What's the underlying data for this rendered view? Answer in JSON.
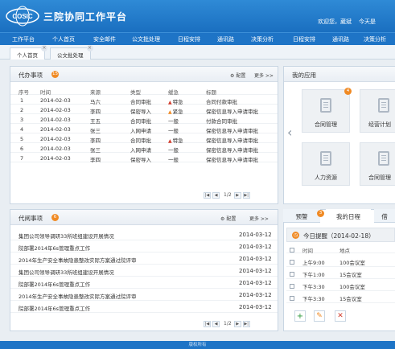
{
  "header": {
    "logo_text": "COSIC",
    "title": "三院协同工作平台",
    "welcome": "欢迎您，葳斌",
    "today": "今天是"
  },
  "nav": [
    "工作平台",
    "个人首页",
    "安全邮件",
    "公文批处理",
    "日程安排",
    "通讯路",
    "决策分析",
    "日程安排",
    "通讯路",
    "决策分析"
  ],
  "tabs": [
    "个人首页",
    "公文批处理"
  ],
  "todo": {
    "title": "代办事项",
    "badge": "15",
    "config": "配置",
    "more": "更多 >>",
    "columns": [
      "序号",
      "时间",
      "来源",
      "类型",
      "缓急",
      "标题"
    ],
    "rows": [
      {
        "no": "1",
        "time": "2014-02-03",
        "source": "马六",
        "type": "合同审批",
        "urgency": "特急",
        "urgency_mark": "red",
        "title": "合同付款审批"
      },
      {
        "no": "2",
        "time": "2014-02-03",
        "source": "李四",
        "type": "保密导入",
        "urgency": "紧急",
        "urgency_mark": "orange",
        "title": "保密信息导入申请审批"
      },
      {
        "no": "3",
        "time": "2014-02-03",
        "source": "王五",
        "type": "合同审批",
        "urgency": "一般",
        "urgency_mark": "",
        "title": "付款合同审批"
      },
      {
        "no": "4",
        "time": "2014-02-03",
        "source": "张三",
        "type": "入网申请",
        "urgency": "一般",
        "urgency_mark": "",
        "title": "保密信息导入申请审批"
      },
      {
        "no": "5",
        "time": "2014-02-03",
        "source": "李四",
        "type": "合同审批",
        "urgency": "特急",
        "urgency_mark": "red",
        "title": "保密信息导入申请审批"
      },
      {
        "no": "6",
        "time": "2014-02-03",
        "source": "张三",
        "type": "入网申请",
        "urgency": "一般",
        "urgency_mark": "",
        "title": "保密信息导入申请审批"
      },
      {
        "no": "7",
        "time": "2014-02-03",
        "source": "李四",
        "type": "保密导入",
        "urgency": "一般",
        "urgency_mark": "",
        "title": "保密信息导入申请审批"
      }
    ],
    "page": "1/2"
  },
  "read": {
    "title": "代阅事项",
    "badge": "6",
    "config": "配置",
    "more": "更多 >>",
    "rows": [
      {
        "title": "集团公司领导调研33所班组建设开展情况",
        "date": "2014-03-12"
      },
      {
        "title": "院部署2014年6s管理重点工作",
        "date": "2014-03-12"
      },
      {
        "title": "2014年生产安全事故隐患整改实际方案通过院评审",
        "date": "2014-03-12"
      },
      {
        "title": "集团公司领导调研33所班组建设开展情况",
        "date": "2014-03-12"
      },
      {
        "title": "院部署2014年6s管理重点工作",
        "date": "2014-03-12"
      },
      {
        "title": "2014年生产安全事故隐患整改实际方案通过院评审",
        "date": "2014-03-12"
      },
      {
        "title": "院部署2014年6s管理重点工作",
        "date": "2014-03-12"
      }
    ],
    "page": "1/2"
  },
  "apps": {
    "title": "我的应用",
    "badge": "4",
    "tiles": [
      "合同管理",
      "经营计划",
      "人力资源",
      "合同管理"
    ]
  },
  "schedule": {
    "tabs": [
      "预警",
      "我的日程",
      "借"
    ],
    "warn_badge": "3",
    "header": "今日提醒（2014-02-18）",
    "columns": [
      "时间",
      "地点"
    ],
    "rows": [
      {
        "time": "上午9:00",
        "place": "100会议室"
      },
      {
        "time": "下午1:00",
        "place": "15会议室"
      },
      {
        "time": "下午3:30",
        "place": "100会议室"
      },
      {
        "time": "下午3:30",
        "place": "15会议室"
      }
    ]
  },
  "footer": "版权所有",
  "colors": {
    "brand": "#1e74c6",
    "accent": "#f08a24",
    "urgent": "#d23b2b",
    "add": "#2e9a3c"
  }
}
